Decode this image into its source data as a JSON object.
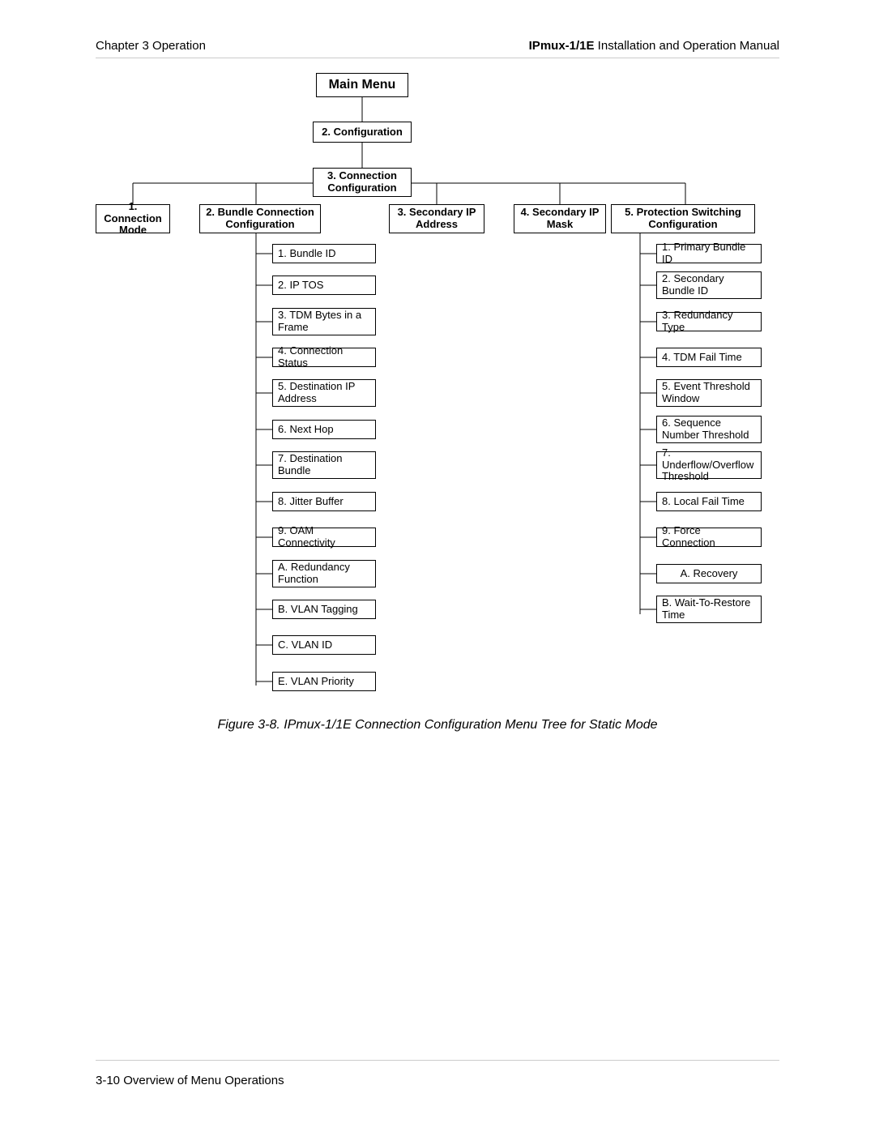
{
  "header": {
    "chapter": "Chapter 3  Operation",
    "product": "IPmux-1/1E",
    "doc": " Installation and Operation Manual"
  },
  "footer": "3-10 Overview of Menu Operations",
  "diagram": {
    "main": "Main Menu",
    "configuration": "2. Configuration",
    "connection_config": "3. Connection Configuration",
    "categories": {
      "c1": "1. Connection Mode",
      "c2": "2. Bundle Connection Configuration",
      "c3": "3. Secondary IP Address",
      "c4": "4. Secondary IP Mask",
      "c5": "5. Protection Switching Configuration"
    },
    "bundle_items": {
      "i1": "1. Bundle ID",
      "i2": "2. IP TOS",
      "i3": "3. TDM Bytes in a Frame",
      "i4": "4. Connection Status",
      "i5": "5. Destination IP Address",
      "i6": "6. Next Hop",
      "i7": "7. Destination Bundle",
      "i8": "8. Jitter Buffer",
      "i9": "9. OAM Connectivity",
      "iA": "A. Redundancy Function",
      "iB": "B. VLAN Tagging",
      "iC": "C. VLAN ID",
      "iE": "E. VLAN Priority"
    },
    "protect_items": {
      "p1": "1. Primary Bundle ID",
      "p2": "2. Secondary Bundle ID",
      "p3": "3. Redundancy Type",
      "p4": "4. TDM Fail Time",
      "p5": "5. Event Threshold Window",
      "p6": "6. Sequence Number Threshold",
      "p7": "7. Underflow/Overflow Threshold",
      "p8": "8. Local Fail Time",
      "p9": "9. Force Connection",
      "pA": "A. Recovery",
      "pB": "B. Wait-To-Restore Time"
    }
  },
  "caption": "Figure 3-8.  IPmux-1/1E Connection Configuration Menu Tree for Static Mode"
}
